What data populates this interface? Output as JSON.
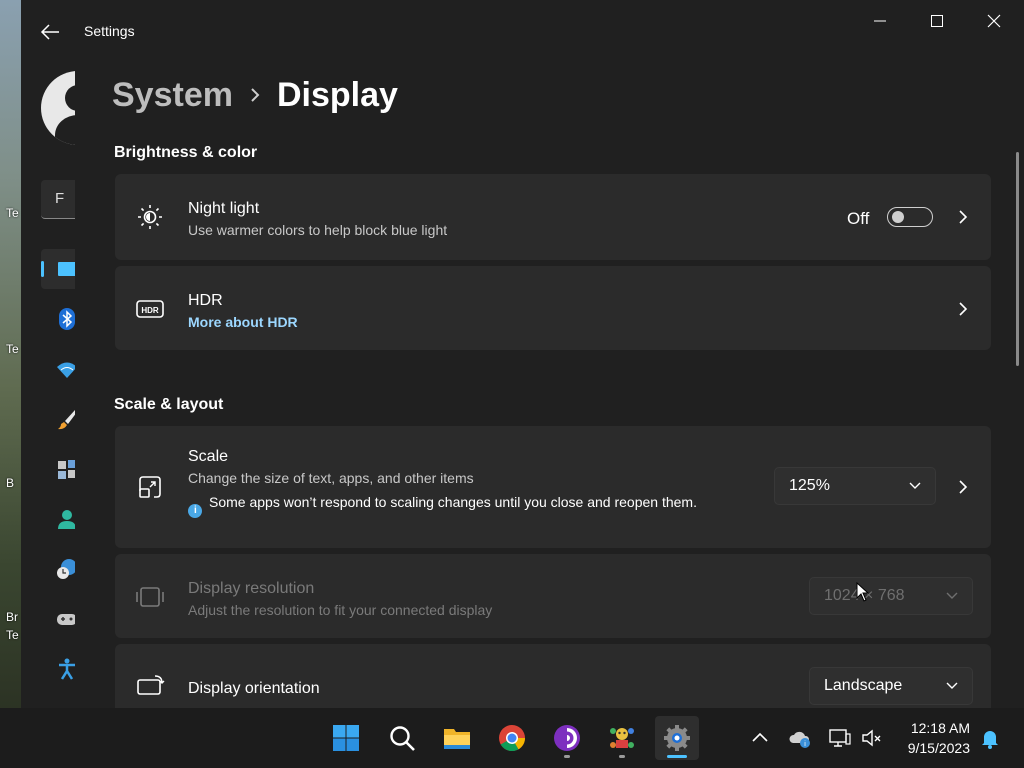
{
  "desktop": {
    "labels": [
      "Te",
      "Te",
      "B",
      "Br",
      "Te"
    ]
  },
  "window": {
    "title": "Settings"
  },
  "search": {
    "value": "F"
  },
  "breadcrumb": {
    "parent": "System",
    "current": "Display"
  },
  "sections": {
    "brightness": "Brightness & color",
    "scale": "Scale & layout"
  },
  "night_light": {
    "title": "Night light",
    "subtitle": "Use warmer colors to help block blue light",
    "state_label": "Off",
    "enabled": false
  },
  "hdr": {
    "title": "HDR",
    "link": "More about HDR"
  },
  "scale": {
    "title": "Scale",
    "subtitle": "Change the size of text, apps, and other items",
    "info": "Some apps won’t respond to scaling changes until you close and reopen them.",
    "value": "125%"
  },
  "resolution": {
    "title": "Display resolution",
    "subtitle": "Adjust the resolution to fit your connected display",
    "value": "1024 × 768"
  },
  "orientation": {
    "title": "Display orientation",
    "value": "Landscape"
  },
  "nav": {
    "items": [
      "system-icon",
      "bluetooth-icon",
      "wifi-icon",
      "brush-icon",
      "apps-icon",
      "accounts-icon",
      "time-language-icon",
      "gaming-icon",
      "accessibility-icon"
    ],
    "active_index": 0
  },
  "taskbar": {
    "apps": [
      "windows-start-icon",
      "search-icon",
      "file-explorer-icon",
      "chrome-icon",
      "tor-browser-icon",
      "app-icon",
      "settings-icon"
    ],
    "time": "12:18 AM",
    "date": "9/15/2023"
  },
  "colors": {
    "accent": "#4cc2ff",
    "link": "#9cd7ff",
    "window_bg": "#202020",
    "card_bg": "#2b2b2b"
  }
}
